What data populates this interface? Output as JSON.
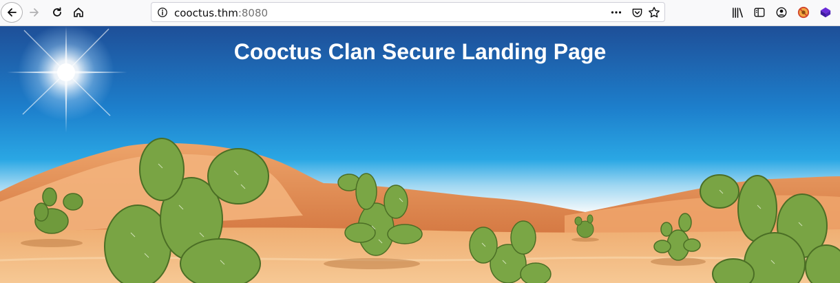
{
  "browser": {
    "url_host": "cooctus.thm",
    "url_port": ":8080"
  },
  "page": {
    "title": "Cooctus Clan Secure Landing Page"
  },
  "icons": {
    "back": "back-arrow-icon",
    "forward": "forward-arrow-icon",
    "reload": "reload-icon",
    "home": "home-icon",
    "site_info": "info-icon",
    "page_actions": "more-dots-icon",
    "pocket": "pocket-icon",
    "bookmark": "star-icon",
    "library": "library-icon",
    "sidebar": "sidebar-icon",
    "account": "account-icon",
    "ext1": "blocked-extension-icon",
    "ext2": "purple-cube-extension-icon"
  },
  "colors": {
    "sky_top": "#1e56a0",
    "sky_bottom": "#d7effa",
    "sand": "#f1b97e",
    "cactus": "#6e9a3a"
  }
}
